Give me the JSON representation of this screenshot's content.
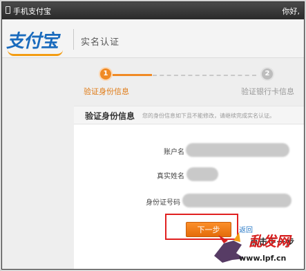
{
  "titlebar": {
    "title": "手机支付宝",
    "greeting": "你好,"
  },
  "header": {
    "logo": "支付宝",
    "page_title": "实名认证"
  },
  "steps": [
    {
      "number": "1",
      "label": "验证身份信息",
      "active": true
    },
    {
      "number": "2",
      "label": "验证银行卡信息",
      "active": false
    }
  ],
  "section": {
    "title": "验证身份信息",
    "hint": "您的身份信息如下且不能修改，请继续完成实名认证。"
  },
  "fields": [
    {
      "label": "账户名"
    },
    {
      "label": "真实姓名"
    },
    {
      "label": "身份证号码"
    }
  ],
  "actions": {
    "next_label": "下一步",
    "back_label": "返回",
    "overlay_caption": "点击下一步"
  },
  "watermark": {
    "text": "乱发网",
    "url": "www.lpf.cn"
  },
  "colors": {
    "accent": "#f08a24",
    "brand": "#1a6bbd",
    "highlight": "#e02020"
  }
}
